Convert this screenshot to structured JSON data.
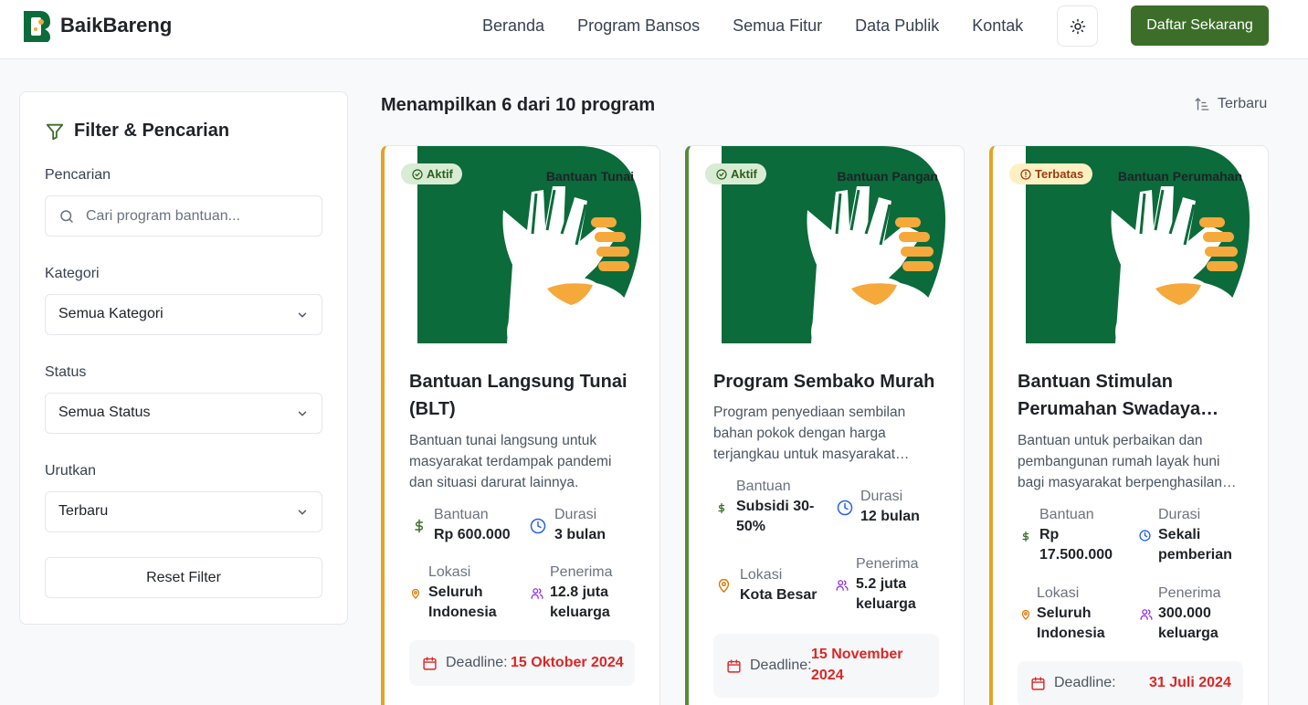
{
  "navbar": {
    "brand": "BaikBareng",
    "links": [
      "Beranda",
      "Program Bansos",
      "Semua Fitur",
      "Data Publik",
      "Kontak"
    ],
    "cta": "Daftar Sekarang"
  },
  "sidebar": {
    "title": "Filter & Pencarian",
    "search": {
      "label": "Pencarian",
      "placeholder": "Cari program bantuan..."
    },
    "category": {
      "label": "Kategori",
      "value": "Semua Kategori"
    },
    "status": {
      "label": "Status",
      "value": "Semua Status"
    },
    "sort": {
      "label": "Urutkan",
      "value": "Terbaru"
    },
    "reset": "Reset Filter"
  },
  "results": {
    "count_text": "Menampilkan 6 dari 10 program",
    "sort_label": "Terbaru"
  },
  "colors": {
    "brand_green": "#3c6e29",
    "image_green": "#0b6b3a",
    "accent_orange": "#f5a93a",
    "deadline_red": "#dc2626"
  },
  "cards": [
    {
      "status": "Aktif",
      "category": "Bantuan Tunai",
      "title": "Bantuan Langsung Tunai (BLT)",
      "description": "Bantuan tunai langsung untuk masyarakat terdampak pandemi dan situasi darurat lainnya.",
      "aid_label": "Bantuan",
      "aid_value": "Rp 600.000",
      "duration_label": "Durasi",
      "duration_value": "3 bulan",
      "location_label": "Lokasi",
      "location_value": "Seluruh Indonesia",
      "recipients_label": "Penerima",
      "recipients_value": "12.8 juta keluarga",
      "deadline_label": "Deadline:",
      "deadline_value": "15 Oktober 2024"
    },
    {
      "status": "Aktif",
      "category": "Bantuan Pangan",
      "title": "Program Sembako Murah",
      "description": "Program penyediaan sembilan bahan pokok dengan harga terjangkau untuk masyarakat…",
      "aid_label": "Bantuan",
      "aid_value": "Subsidi 30-50%",
      "duration_label": "Durasi",
      "duration_value": "12 bulan",
      "location_label": "Lokasi",
      "location_value": "Kota Besar",
      "recipients_label": "Penerima",
      "recipients_value": "5.2 juta keluarga",
      "deadline_label": "Deadline:",
      "deadline_value": "15 November 2024"
    },
    {
      "status": "Terbatas",
      "category": "Bantuan Perumahan",
      "title": "Bantuan Stimulan Perumahan Swadaya…",
      "description": "Bantuan untuk perbaikan dan pembangunan rumah layak huni bagi masyarakat berpenghasilan…",
      "aid_label": "Bantuan",
      "aid_value": "Rp 17.500.000",
      "duration_label": "Durasi",
      "duration_value": "Sekali pemberian",
      "location_label": "Lokasi",
      "location_value": "Seluruh Indonesia",
      "recipients_label": "Penerima",
      "recipients_value": "300.000 keluarga",
      "deadline_label": "Deadline:",
      "deadline_value": "31 Juli 2024"
    }
  ]
}
